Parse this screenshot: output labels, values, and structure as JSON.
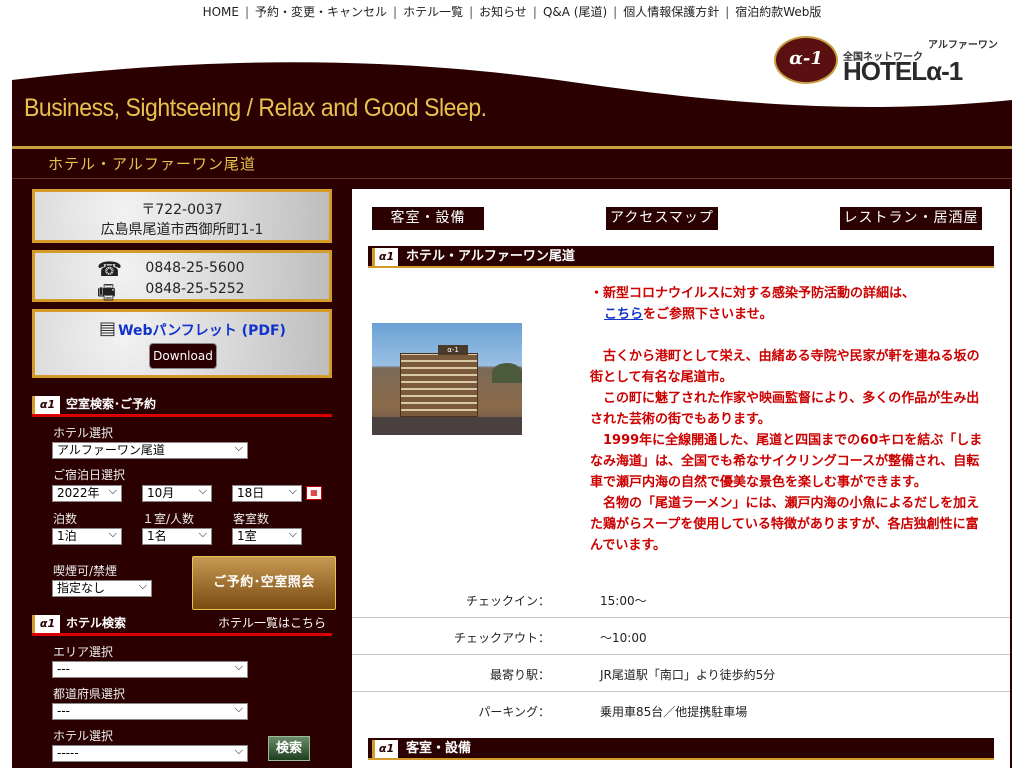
{
  "nav": {
    "items": [
      "HOME",
      "予約・変更・キャンセル",
      "ホテル一覧",
      "お知らせ",
      "Q&A (尾道)",
      "個人情報保護方針",
      "宿泊約款Web版"
    ]
  },
  "logo": {
    "badge": "α-1",
    "network": "全国ネットワーク",
    "kana": "アルファーワン",
    "brand": "HOTELα-1"
  },
  "banner": {
    "tagline": "Business, Sightseeing / Relax and Good Sleep."
  },
  "hotel_name": "ホテル・アルファーワン尾道",
  "address": {
    "zip": "〒722-0037",
    "line": "広島県尾道市西御所町1-1"
  },
  "contact": {
    "tel": "0848-25-5600",
    "fax": "0848-25-5252"
  },
  "pamphlet": {
    "label": "Webパンフレット (PDF)",
    "download": "Download"
  },
  "booking": {
    "header": "空室検索･ご予約",
    "hotel_label": "ホテル選択",
    "hotel_value": "アルファーワン尾道",
    "date_label": "ご宿泊日選択",
    "year": "2022年",
    "month": "10月",
    "day": "18日",
    "nights_label": "泊数",
    "nights": "1泊",
    "people_label": "１室/人数",
    "people": "1名",
    "rooms_label": "客室数",
    "rooms": "1室",
    "smoking_label": "喫煙可/禁煙",
    "smoking": "指定なし",
    "submit": "ご予約･空室照会"
  },
  "hotel_search": {
    "header": "ホテル検索",
    "list_link": "ホテル一覧はこちら",
    "area_label": "エリア選択",
    "area": "---",
    "pref_label": "都道府県選択",
    "pref": "---",
    "hotel_label": "ホテル選択",
    "hotel": "-----",
    "submit": "検索"
  },
  "tabs": [
    "客室・設備",
    "アクセスマップ",
    "レストラン・居酒屋"
  ],
  "content": {
    "header": "ホテル・アルファーワン尾道",
    "covid_line1": "・新型コロナウイルスに対する感染予防活動の詳細は、",
    "covid_link": "こちら",
    "covid_line2": "をご参照下さいませ。",
    "para1": "　古くから港町として栄え、由緒ある寺院や民家が軒を連ねる坂の街として有名な尾道市。",
    "para2": "　この町に魅了された作家や映画監督により、多くの作品が生み出された芸術の街でもあります。",
    "para3": "　1999年に全線開通した、尾道と四国までの60キロを結ぶ「しまなみ海道」は、全国でも希なサイクリングコースが整備され、自転車で瀬戸内海の自然で優美な景色を楽しむ事ができます。",
    "para4": "　名物の「尾道ラーメン」には、瀬戸内海の小魚によるだしを加えた鶏がらスープを使用している特徴がありますが、各店独創性に富んでいます。",
    "photo_sign": "α-1"
  },
  "info_rows": [
    {
      "k": "チェックイン：",
      "v": "15:00〜"
    },
    {
      "k": "チェックアウト：",
      "v": "〜10:00"
    },
    {
      "k": "最寄り駅：",
      "v": "JR尾道駅「南口」より徒歩約5分"
    },
    {
      "k": "パーキング：",
      "v": "乗用車85台／他提携駐車場"
    }
  ],
  "rooms_header": "客室・設備",
  "colors": {
    "maroon": "#2a0000",
    "gold": "#e7c34d",
    "accent_red": "#cc0000"
  }
}
